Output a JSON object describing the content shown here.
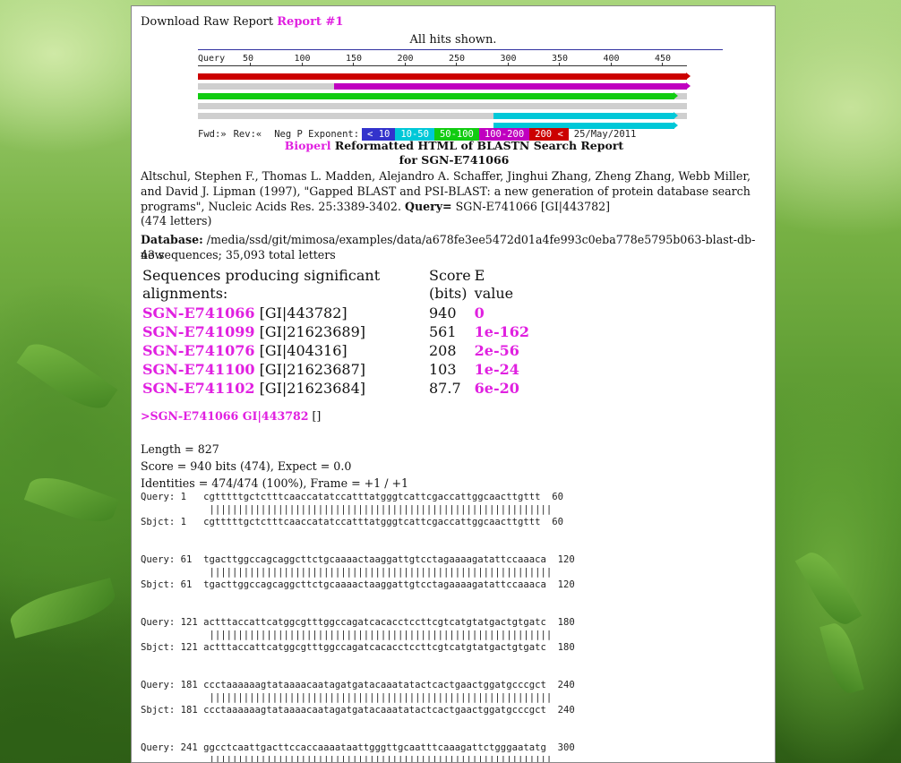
{
  "download": {
    "label": "Download Raw Report",
    "link": "Report #1"
  },
  "all_hits": "All hits shown.",
  "graphic": {
    "query_label": "Query",
    "ticks": [
      "50",
      "100",
      "150",
      "200",
      "250",
      "300",
      "350",
      "400",
      "450"
    ],
    "legend": {
      "fwd": "Fwd:»",
      "rev": "Rev:«",
      "neg_p": "Neg P Exponent:",
      "bins": [
        {
          "label": "< 10",
          "color": "#3333cc"
        },
        {
          "label": "10-50",
          "color": "#00c8d8"
        },
        {
          "label": "50-100",
          "color": "#11cc11"
        },
        {
          "label": "100-200",
          "color": "#c000c0"
        },
        {
          "label": "200 <",
          "color": "#cc0000"
        }
      ],
      "date": "25/May/2011"
    },
    "colors": {
      "red": "#cc0000",
      "magenta": "#c000c0",
      "green": "#11cc11",
      "cyan": "#00c8d8",
      "grey": "#cfcfcf"
    }
  },
  "title": {
    "bioperl": "Bioperl",
    "line1": " Reformatted HTML of BLASTN Search Report",
    "line2": "for SGN-E741066"
  },
  "citation": {
    "text": "Altschul, Stephen F., Thomas L. Madden, Alejandro A. Schaffer, Jinghui Zhang, Zheng Zhang, Webb Miller, and David J. Lipman (1997), \"Gapped BLAST and PSI-BLAST: a new generation of protein database search programs\", Nucleic Acids Res. 25:3389-3402.",
    "query_label": "Query=",
    "query_value": " SGN-E741066 [GI|443782]",
    "letters": "(474 letters)"
  },
  "database": {
    "label": "Database:",
    "path": " /media/ssd/git/mimosa/examples/data/a678fe3ee5472d01a4fe993c0eba778e5795b063-blast-db-new",
    "summary": "43 sequences; 35,093 total letters"
  },
  "hits_table": {
    "header_seq": "Sequences producing significant alignments:",
    "header_score": "Score\n(bits)",
    "header_e": "E\nvalue",
    "rows": [
      {
        "id": "SGN-E741066",
        "gi": " [GI|443782]",
        "score": "940",
        "e": "0"
      },
      {
        "id": "SGN-E741099",
        "gi": " [GI|21623689]",
        "score": "561",
        "e": "1e-162"
      },
      {
        "id": "SGN-E741076",
        "gi": " [GI|404316]",
        "score": "208",
        "e": "2e-56"
      },
      {
        "id": "SGN-E741100",
        "gi": " [GI|21623687]",
        "score": "103",
        "e": "1e-24"
      },
      {
        "id": "SGN-E741102",
        "gi": " [GI|21623684]",
        "score": "87.7",
        "e": "6e-20"
      }
    ]
  },
  "alignment": {
    "anchor": ">SGN-E741066 GI|443782",
    "suffix": " []",
    "length": "Length = 827",
    "score": "Score = 940 bits (474), Expect = 0.0",
    "identities": "Identities = 474/474 (100%), Frame = +1 / +1",
    "blocks": [
      "Query: 1   cgtttttgctctttcaaccatatccatttatgggtcattcgaccattggcaacttgttt  60\n            ||||||||||||||||||||||||||||||||||||||||||||||||||||||||||||\nSbjct: 1   cgtttttgctctttcaaccatatccatttatgggtcattcgaccattggcaacttgttt  60",
      "Query: 61  tgacttggccagcaggcttctgcaaaactaaggattgtcctagaaaagatattccaaaca  120\n            ||||||||||||||||||||||||||||||||||||||||||||||||||||||||||||\nSbjct: 61  tgacttggccagcaggcttctgcaaaactaaggattgtcctagaaaagatattccaaaca  120",
      "Query: 121 actttaccattcatggcgtttggccagatcacacctccttcgtcatgtatgactgtgatc  180\n            ||||||||||||||||||||||||||||||||||||||||||||||||||||||||||||\nSbjct: 121 actttaccattcatggcgtttggccagatcacacctccttcgtcatgtatgactgtgatc  180",
      "Query: 181 ccctaaaaaagtataaaacaatagatgatacaaatatactcactgaactggatgcccgct  240\n            ||||||||||||||||||||||||||||||||||||||||||||||||||||||||||||\nSbjct: 181 ccctaaaaaagtataaaacaatagatgatacaaatatactcactgaactggatgcccgct  240",
      "Query: 241 ggcctcaattgacttccaccaaaataattgggttgcaatttcaaagattctgggaatatg  300\n            ||||||||||||||||||||||||||||||||||||||||||||||||||||||||||||"
    ]
  }
}
